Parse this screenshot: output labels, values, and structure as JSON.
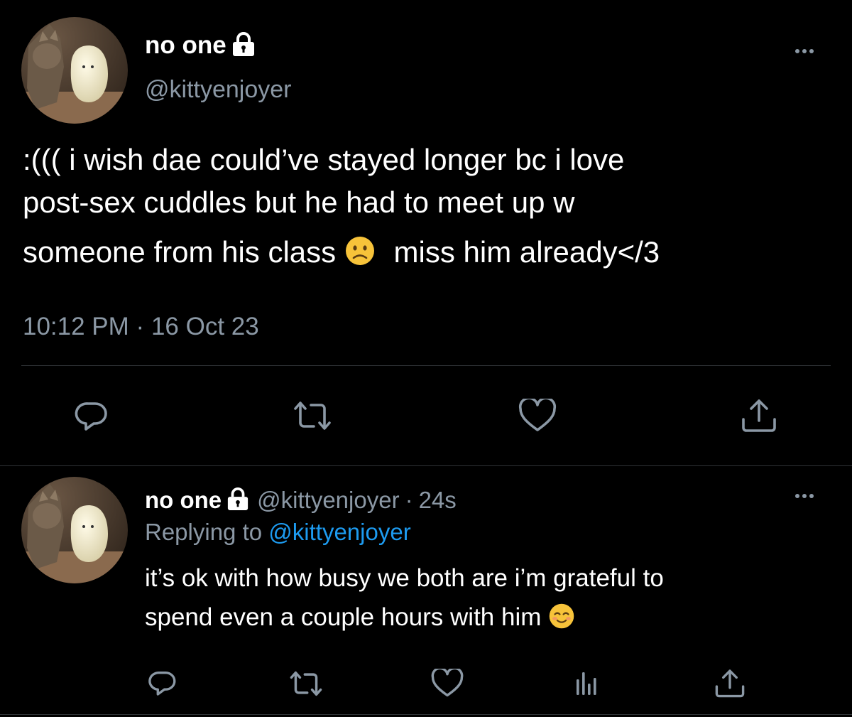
{
  "main_tweet": {
    "display_name": "no one",
    "handle": "@kittyenjoyer",
    "text_line1": ":((( i wish dae could’ve stayed longer bc i love",
    "text_line2": "post-sex cuddles but he had to meet up w",
    "text_line3a": "someone from his class",
    "text_line3b": "miss him already</3",
    "time": "10:12 PM",
    "separator": "·",
    "date": "16 Oct 23",
    "icons": {
      "reply": "reply-icon",
      "retweet": "retweet-icon",
      "like": "heart-icon",
      "share": "share-icon"
    }
  },
  "reply_tweet": {
    "display_name": "no one",
    "handle": "@kittyenjoyer",
    "separator": "·",
    "age": "24s",
    "replying_prefix": "Replying to",
    "replying_handle": "@kittyenjoyer",
    "text_line1": "it’s ok with how busy we both are i’m grateful to",
    "text_line2": "spend even a couple hours with him",
    "icons": {
      "reply": "reply-icon",
      "retweet": "retweet-icon",
      "like": "heart-icon",
      "views": "analytics-icon",
      "share": "share-icon"
    }
  },
  "colors": {
    "background": "#000000",
    "text": "#ffffff",
    "secondary": "#8b98a5",
    "link": "#1d9bf0",
    "divider": "#2f3336"
  }
}
